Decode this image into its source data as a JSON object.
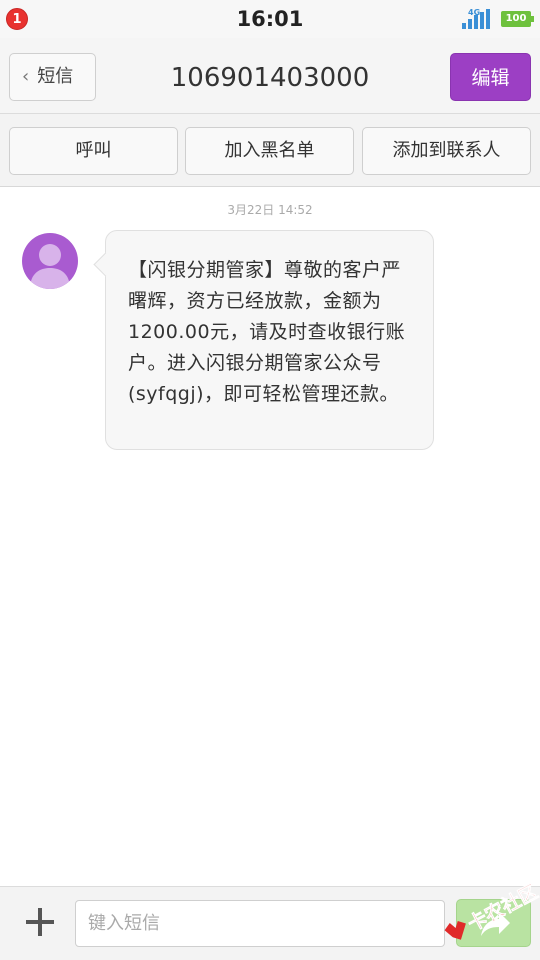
{
  "status_bar": {
    "notification_count": "1",
    "time": "16:01",
    "network": "4G",
    "battery": "100"
  },
  "header": {
    "back_label": "短信",
    "title": "106901403000",
    "edit_label": "编辑"
  },
  "actions": {
    "call": "呼叫",
    "blacklist": "加入黑名单",
    "add_contact": "添加到联系人"
  },
  "conversation": {
    "timestamp": "3月22日 14:52",
    "messages": [
      {
        "text": "【闪银分期管家】尊敬的客户严曙辉，资方已经放款，金额为1200.00元，请及时查收银行账户。进入闪银分期管家公众号(syfqgj)，即可轻松管理还款。"
      }
    ]
  },
  "composer": {
    "placeholder": "键入短信"
  },
  "watermark": {
    "text": "卡农社区"
  },
  "colors": {
    "accent": "#9c3fc4",
    "send": "#b9e3a2",
    "badge": "#e8322f",
    "battery": "#6ec13d"
  }
}
